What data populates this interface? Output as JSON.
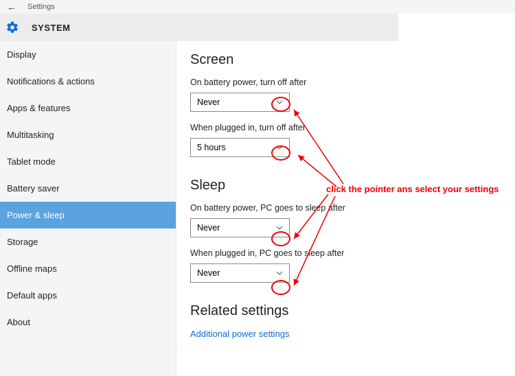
{
  "titlebar": {
    "label": "Settings"
  },
  "header": {
    "title": "SYSTEM"
  },
  "sidebar": {
    "items": [
      {
        "label": "Display"
      },
      {
        "label": "Notifications & actions"
      },
      {
        "label": "Apps & features"
      },
      {
        "label": "Multitasking"
      },
      {
        "label": "Tablet mode"
      },
      {
        "label": "Battery saver"
      },
      {
        "label": "Power & sleep"
      },
      {
        "label": "Storage"
      },
      {
        "label": "Offline maps"
      },
      {
        "label": "Default apps"
      },
      {
        "label": "About"
      }
    ],
    "active_index": 6
  },
  "content": {
    "screen": {
      "heading": "Screen",
      "battery_label": "On battery power, turn off after",
      "battery_value": "Never",
      "plugged_label": "When plugged in, turn off after",
      "plugged_value": "5 hours"
    },
    "sleep": {
      "heading": "Sleep",
      "battery_label": "On battery power, PC goes to sleep after",
      "battery_value": "Never",
      "plugged_label": "When plugged in, PC goes to sleep after",
      "plugged_value": "Never"
    },
    "related": {
      "heading": "Related settings",
      "link": "Additional power settings"
    }
  },
  "annotation": {
    "text": "click the pointer ans select your settings"
  }
}
